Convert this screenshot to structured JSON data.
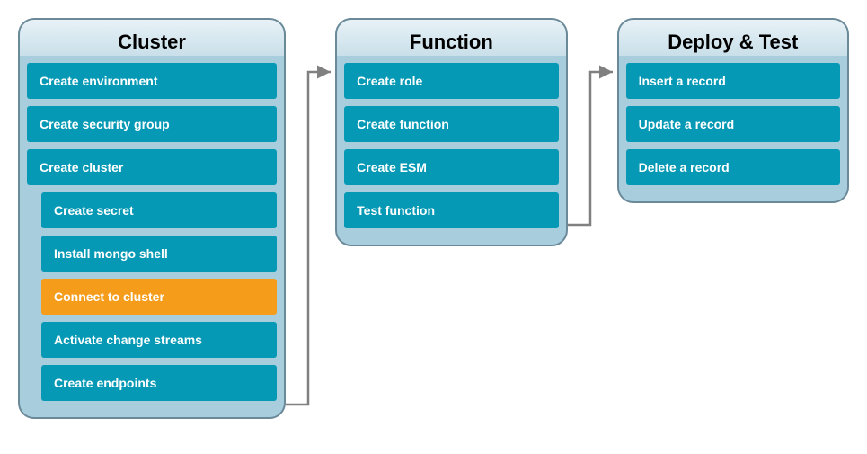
{
  "panels": {
    "cluster": {
      "title": "Cluster",
      "steps": [
        {
          "label": "Create environment",
          "sub": false,
          "active": false
        },
        {
          "label": "Create security group",
          "sub": false,
          "active": false
        },
        {
          "label": "Create cluster",
          "sub": false,
          "active": false
        },
        {
          "label": "Create secret",
          "sub": true,
          "active": false
        },
        {
          "label": "Install mongo shell",
          "sub": true,
          "active": false
        },
        {
          "label": "Connect to cluster",
          "sub": true,
          "active": true
        },
        {
          "label": "Activate change streams",
          "sub": true,
          "active": false
        },
        {
          "label": "Create endpoints",
          "sub": true,
          "active": false
        }
      ]
    },
    "function": {
      "title": "Function",
      "steps": [
        {
          "label": "Create role",
          "sub": false,
          "active": false
        },
        {
          "label": "Create function",
          "sub": false,
          "active": false
        },
        {
          "label": "Create ESM",
          "sub": false,
          "active": false
        },
        {
          "label": "Test function",
          "sub": false,
          "active": false
        }
      ]
    },
    "deploy": {
      "title": "Deploy & Test",
      "steps": [
        {
          "label": "Insert a record",
          "sub": false,
          "active": false
        },
        {
          "label": "Update a record",
          "sub": false,
          "active": false
        },
        {
          "label": "Delete a record",
          "sub": false,
          "active": false
        }
      ]
    }
  },
  "colors": {
    "panel_border": "#6b8a99",
    "panel_bg": "#a8cddd",
    "step_bg": "#0699b5",
    "step_active": "#f59c1a",
    "arrow": "#808080"
  }
}
